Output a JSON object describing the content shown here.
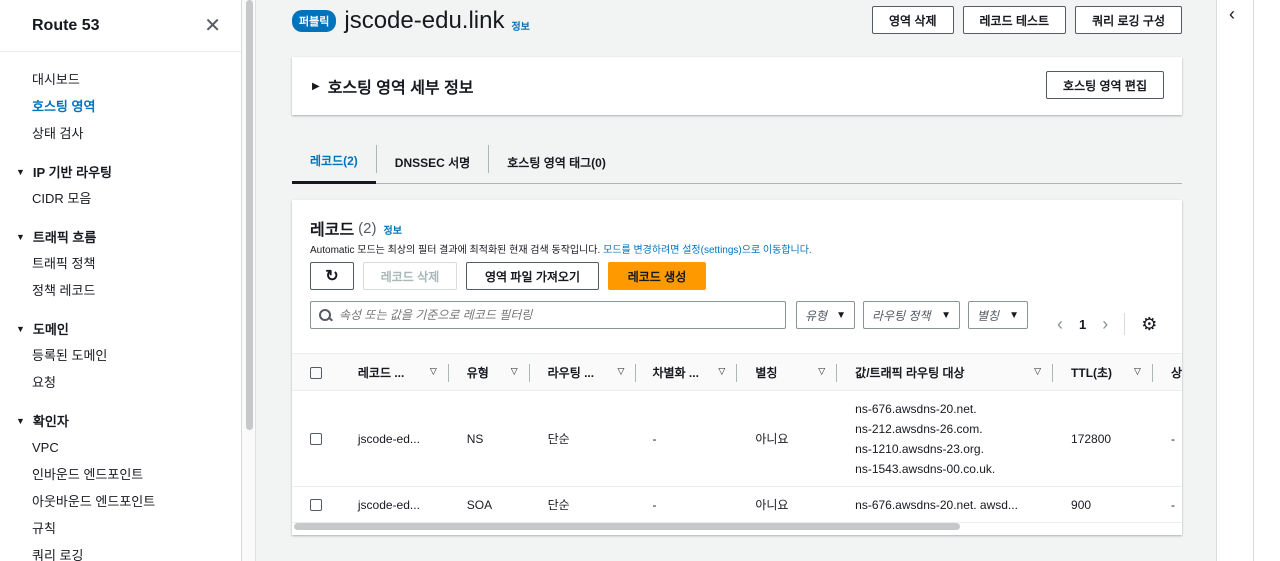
{
  "sidebar": {
    "title": "Route 53",
    "close_icon": "✕",
    "top_items": [
      "대시보드",
      "호스팅 영역",
      "상태 검사"
    ],
    "sections": [
      {
        "label": "IP 기반 라우팅",
        "items": [
          "CIDR 모음"
        ]
      },
      {
        "label": "트래픽 흐름",
        "items": [
          "트래픽 정책",
          "정책 레코드"
        ]
      },
      {
        "label": "도메인",
        "items": [
          "등록된 도메인",
          "요청"
        ]
      },
      {
        "label": "확인자",
        "items": [
          "VPC",
          "인바운드 엔드포인트",
          "아웃바운드 엔드포인트",
          "규칙",
          "쿼리 로깅"
        ]
      }
    ]
  },
  "header": {
    "badge": "퍼블릭",
    "title": "jscode-edu.link",
    "info": "정보",
    "buttons": {
      "delete": "영역 삭제",
      "test": "레코드 테스트",
      "logging": "쿼리 로깅 구성"
    }
  },
  "zone_details": {
    "title": "호스팅 영역 세부 정보",
    "edit_button": "호스팅 영역 편집"
  },
  "tabs": {
    "records": "레코드(2)",
    "dnssec": "DNSSEC 서명",
    "tags": "호스팅 영역 태그(0)"
  },
  "records": {
    "title": "레코드",
    "count": "(2)",
    "info": "정보",
    "desc_prefix": "Automatic 모드는 최상의 필터 결과에 최적화된 현재 검색 동작입니다.",
    "desc_link": "모드를 변경하려면 설정(settings)으로 이동합니다.",
    "btn_refresh": "↻",
    "btn_delete": "레코드 삭제",
    "btn_import": "영역 파일 가져오기",
    "btn_create": "레코드 생성",
    "filter_placeholder": "속성 또는 값을 기준으로 레코드 필터링",
    "dd_type": "유형",
    "dd_routing": "라우팅 정책",
    "dd_alias": "별칭",
    "page": "1",
    "columns": {
      "name": "레코드 ...",
      "type": "유형",
      "routing": "라우팅 ...",
      "diff": "차별화 ...",
      "alias": "별칭",
      "value": "값/트래픽 라우팅 대상",
      "ttl": "TTL(초)",
      "health": "상"
    },
    "rows": [
      {
        "name": "jscode-ed...",
        "type": "NS",
        "routing": "단순",
        "diff": "-",
        "alias": "아니요",
        "value": [
          "ns-676.awsdns-20.net.",
          "ns-212.awsdns-26.com.",
          "ns-1210.awsdns-23.org.",
          "ns-1543.awsdns-00.co.uk."
        ],
        "ttl": "172800",
        "health": "-"
      },
      {
        "name": "jscode-ed...",
        "type": "SOA",
        "routing": "단순",
        "diff": "-",
        "alias": "아니요",
        "value": [
          "ns-676.awsdns-20.net. awsd..."
        ],
        "ttl": "900",
        "health": "-"
      }
    ]
  }
}
